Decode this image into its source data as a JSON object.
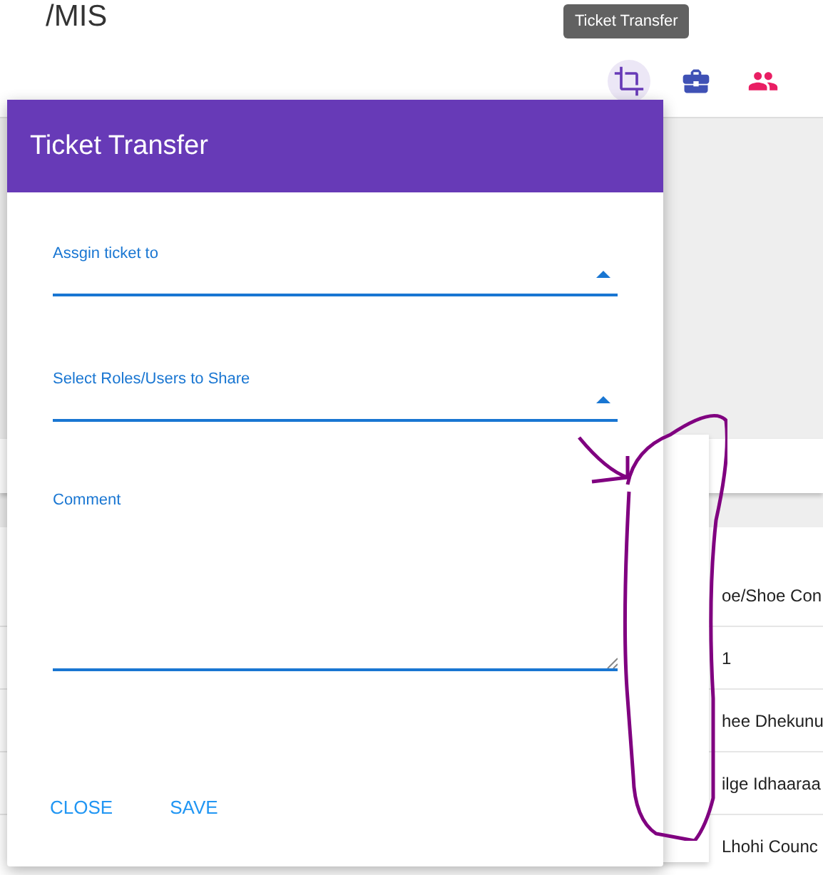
{
  "page": {
    "title_left": "/MIS"
  },
  "toolbar": {
    "icons": [
      {
        "kind": "crop",
        "active": true
      },
      {
        "kind": "briefcase",
        "active": false
      },
      {
        "kind": "people",
        "active": false
      }
    ],
    "tooltip": "Ticket Transfer"
  },
  "table": {
    "rows": [
      {
        "column_2": "oe/Shoe Con"
      },
      {
        "column_2": "1"
      },
      {
        "column_2": "hee Dhekunu"
      },
      {
        "column_2": "ilge Idhaaraa"
      },
      {
        "column_2": "Lhohi Counc"
      }
    ]
  },
  "dialog": {
    "title": "Ticket Transfer",
    "fields": [
      {
        "kind": "select",
        "label": "Assgin ticket to"
      },
      {
        "kind": "select",
        "label": "Select Roles/Users to Share"
      },
      {
        "kind": "textarea",
        "label": "Comment"
      }
    ],
    "buttons": [
      "CLOSE",
      "SAVE"
    ]
  },
  "annotation": {
    "kind": "scribble"
  }
}
